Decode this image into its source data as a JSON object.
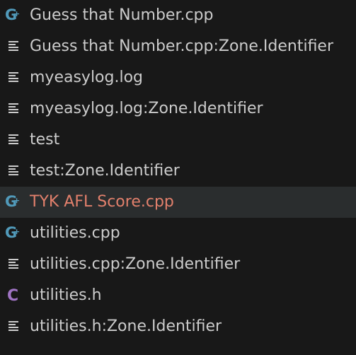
{
  "colors": {
    "background": "#181818",
    "selected_row": "#2a2d2e",
    "text": "#cccccc",
    "modified_text": "#e2806c",
    "cpp_icon": "#519aba",
    "h_icon": "#a074c4",
    "text_icon": "#cccccc"
  },
  "files": [
    {
      "name": "Guess that Number.cpp",
      "icon": "cpp-icon"
    },
    {
      "name": "Guess that Number.cpp:Zone.Identifier",
      "icon": "text-file-icon"
    },
    {
      "name": "myeasylog.log",
      "icon": "text-file-icon"
    },
    {
      "name": "myeasylog.log:Zone.Identifier",
      "icon": "text-file-icon"
    },
    {
      "name": "test",
      "icon": "text-file-icon"
    },
    {
      "name": "test:Zone.Identifier",
      "icon": "text-file-icon"
    },
    {
      "name": "TYK AFL Score.cpp",
      "icon": "cpp-icon",
      "selected": true,
      "modified": true
    },
    {
      "name": "utilities.cpp",
      "icon": "cpp-icon"
    },
    {
      "name": "utilities.cpp:Zone.Identifier",
      "icon": "text-file-icon"
    },
    {
      "name": "utilities.h",
      "icon": "c-header-icon"
    },
    {
      "name": "utilities.h:Zone.Identifier",
      "icon": "text-file-icon"
    }
  ]
}
